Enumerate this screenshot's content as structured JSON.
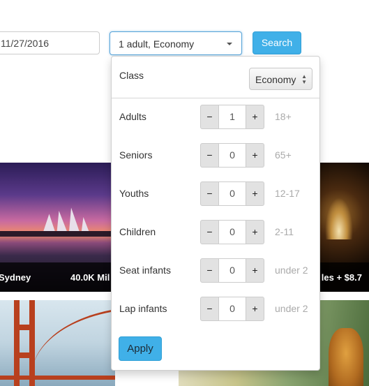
{
  "search_bar": {
    "date_value": "11/27/2016",
    "passengers_value": "1 adult, Economy",
    "search_label": "Search"
  },
  "cards": [
    {
      "name": "Sydney",
      "miles": "40.0K Mil"
    },
    {
      "miles": "les + $8.7"
    }
  ],
  "panel": {
    "class_label": "Class",
    "class_value": "Economy",
    "rows": [
      {
        "label": "Adults",
        "value": "1",
        "age": "18+"
      },
      {
        "label": "Seniors",
        "value": "0",
        "age": "65+"
      },
      {
        "label": "Youths",
        "value": "0",
        "age": "12-17"
      },
      {
        "label": "Children",
        "value": "0",
        "age": "2-11"
      },
      {
        "label": "Seat infants",
        "value": "0",
        "age": "under 2"
      },
      {
        "label": "Lap infants",
        "value": "0",
        "age": "under 2"
      }
    ],
    "minus": "−",
    "plus": "+",
    "apply_label": "Apply"
  },
  "colors": {
    "accent": "#40b0e8",
    "focus_border": "#56a3d9"
  }
}
